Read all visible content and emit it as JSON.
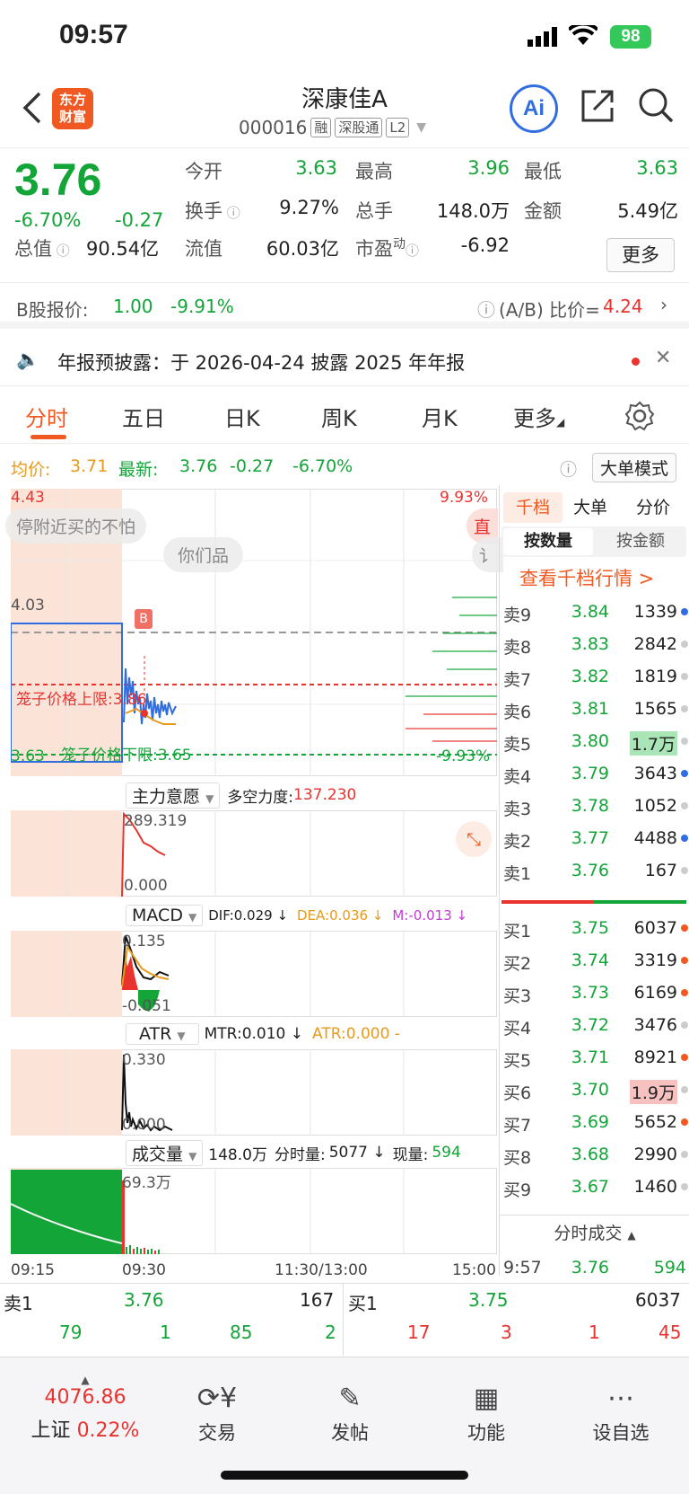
{
  "status": {
    "time": "09:57",
    "battery": "98"
  },
  "header": {
    "logo": [
      "东方",
      "财富"
    ],
    "name": "深康佳A",
    "code": "000016",
    "tags": [
      "融",
      "深股通",
      "L2"
    ],
    "ai": "Ai"
  },
  "quote": {
    "price": "3.76",
    "pct": "-6.70%",
    "chg": "-0.27",
    "labels": {
      "open": "今开",
      "high": "最高",
      "low": "最低",
      "turnover": "换手",
      "volume": "总手",
      "amount": "金额",
      "mcap": "总值",
      "float": "流值",
      "pe": "市盈"
    },
    "pe_sup": "动",
    "open": "3.63",
    "high": "3.96",
    "low": "3.63",
    "turnover": "9.27%",
    "volume": "148.0万",
    "amount": "5.49亿",
    "mcap": "90.54亿",
    "float": "60.03亿",
    "pe": "-6.92",
    "more": "更多"
  },
  "bshare": {
    "label": "B股报价:",
    "price": "1.00",
    "pct": "-9.91%",
    "ratio_label": "(A/B) 比价=",
    "ratio": "4.24"
  },
  "notice": {
    "text": "年报预披露：于 2026-04-24 披露 2025 年年报"
  },
  "tabs": [
    "分时",
    "五日",
    "日K",
    "周K",
    "月K",
    "更多"
  ],
  "avg": {
    "avg_label": "均价:",
    "avg": "3.71",
    "last_label": "最新:",
    "last": "3.76",
    "chg": "-0.27",
    "pct": "-6.70%",
    "bigorder": "大单模式"
  },
  "chart": {
    "top_price": "4.43",
    "top_pct": "9.93%",
    "ref_price": "4.03",
    "bottom_price": "3.63",
    "bottom_pct": "-9.93%",
    "upper_limit_label": "笼子价格上限:",
    "upper_limit": "3.86",
    "lower_limit_label": "笼子价格下限:",
    "lower_limit": "3.65",
    "bubble1": "停附近买的不怕",
    "bubble1b": "直",
    "bubble2": "你们品",
    "bubble2b": "讠",
    "b_marker": "B",
    "ind1": {
      "name": "主力意愿",
      "label": "多空力度:",
      "value": "137.230",
      "max": "289.319",
      "min": "0.000"
    },
    "ind2": {
      "name": "MACD",
      "dif": "DIF:0.029 ↓",
      "dea": "DEA:0.036 ↓",
      "m": "M:-0.013 ↓",
      "max": "0.135",
      "min": "-0.051"
    },
    "ind3": {
      "name": "ATR",
      "mtr": "MTR:0.010 ↓",
      "atr": "ATR:0.000 -",
      "max": "0.330",
      "min": "0.000"
    },
    "ind4": {
      "name": "成交量",
      "total": "148.0万",
      "min_label": "分时量:",
      "min_val": "5077 ↓",
      "now_label": "现量:",
      "now_val": "594",
      "max": "69.3万"
    },
    "times": [
      "09:15",
      "09:30",
      "11:30/13:00",
      "15:00"
    ]
  },
  "book": {
    "tabs": [
      "千档",
      "大单",
      "分价"
    ],
    "subtabs": [
      "按数量",
      "按金额"
    ],
    "link": "查看千档行情 >",
    "asks": [
      {
        "label": "卖9",
        "price": "3.84",
        "vol": "1339"
      },
      {
        "label": "卖8",
        "price": "3.83",
        "vol": "2842"
      },
      {
        "label": "卖7",
        "price": "3.82",
        "vol": "1819"
      },
      {
        "label": "卖6",
        "price": "3.81",
        "vol": "1565"
      },
      {
        "label": "卖5",
        "price": "3.80",
        "vol": "1.7万"
      },
      {
        "label": "卖4",
        "price": "3.79",
        "vol": "3643"
      },
      {
        "label": "卖3",
        "price": "3.78",
        "vol": "1052"
      },
      {
        "label": "卖2",
        "price": "3.77",
        "vol": "4488"
      },
      {
        "label": "卖1",
        "price": "3.76",
        "vol": "167"
      }
    ],
    "bids": [
      {
        "label": "买1",
        "price": "3.75",
        "vol": "6037"
      },
      {
        "label": "买2",
        "price": "3.74",
        "vol": "3319"
      },
      {
        "label": "买3",
        "price": "3.73",
        "vol": "6169"
      },
      {
        "label": "买4",
        "price": "3.72",
        "vol": "3476"
      },
      {
        "label": "买5",
        "price": "3.71",
        "vol": "8921"
      },
      {
        "label": "买6",
        "price": "3.70",
        "vol": "1.9万"
      },
      {
        "label": "买7",
        "price": "3.69",
        "vol": "5652"
      },
      {
        "label": "买8",
        "price": "3.68",
        "vol": "2990"
      },
      {
        "label": "买9",
        "price": "3.67",
        "vol": "1460"
      }
    ],
    "ticks_label": "分时成交",
    "tick": {
      "time": "9:57",
      "price": "3.76",
      "vol": "594"
    }
  },
  "bidask": {
    "ask_label": "卖1",
    "ask_price": "3.76",
    "ask_vol": "167",
    "bid_label": "买1",
    "bid_price": "3.75",
    "bid_vol": "6037",
    "ask_nums": [
      "79",
      "1",
      "85",
      "2"
    ],
    "bid_nums": [
      "17",
      "3",
      "1",
      "45"
    ]
  },
  "nav": {
    "index_value": "4076.86",
    "index_name": "上证",
    "index_pct": "0.22%",
    "items": [
      "交易",
      "发帖",
      "功能",
      "设自选"
    ]
  }
}
